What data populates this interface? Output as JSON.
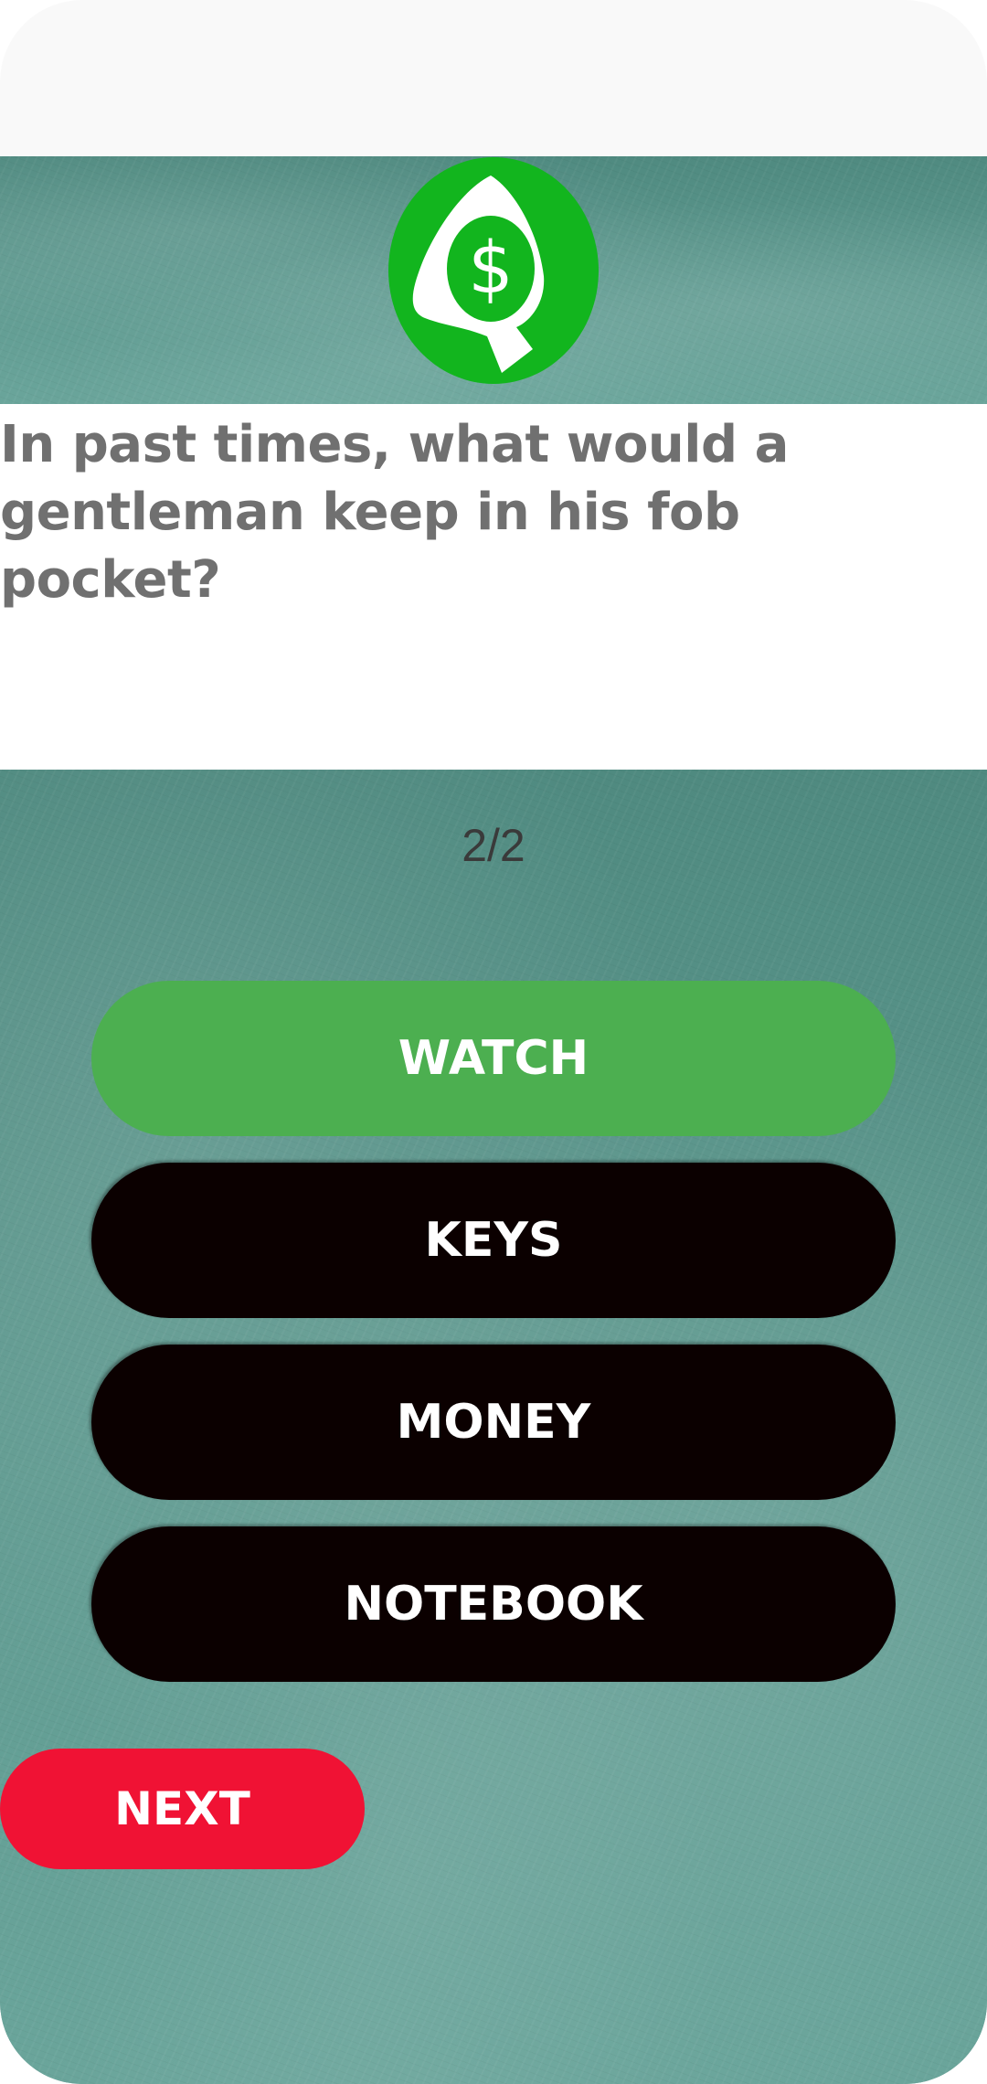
{
  "app": {
    "brand_color": "#12b51e",
    "panel_color": "#5b968c"
  },
  "logo": {
    "icon": "dollar-q-logo-icon",
    "symbol": "$"
  },
  "question": {
    "text": "In past times, what would a gentleman keep in his fob pocket?"
  },
  "quiz": {
    "counter": "2/2",
    "options": [
      {
        "label": "WATCH",
        "state": "correct",
        "color": "#4caf50"
      },
      {
        "label": "KEYS",
        "state": "default",
        "color": "#0b0000"
      },
      {
        "label": "MONEY",
        "state": "default",
        "color": "#0b0000"
      },
      {
        "label": "NOTEBOOK",
        "state": "default",
        "color": "#0b0000"
      }
    ],
    "next_label": "NEXT",
    "next_color": "#f01234"
  }
}
